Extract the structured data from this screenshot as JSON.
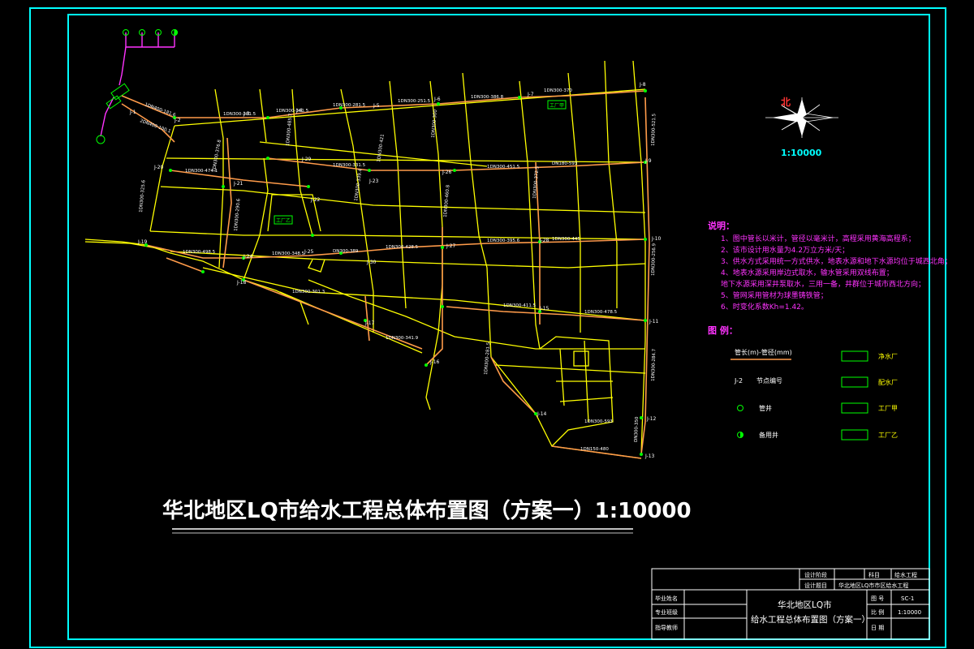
{
  "title_text": "华北地区LQ市给水工程总体布置图（方案一）1:10000",
  "north": {
    "char": "北",
    "scale": "1:10000"
  },
  "notes": {
    "heading": "说明：",
    "items": [
      "1、图中管长以米计，管径以毫米计，高程采用黄海高程系；",
      "2、该市设计用水量为4.2万立方米/天；",
      "3、供水方式采用统一方式供水，地表水源和地下水源均位于城西北角；",
      "4、地表水源采用岸边式取水，输水管采用双线布置；",
      "   地下水源采用深井泵取水，三用一备，井群位于城市西北方向；",
      "5、管网采用管材为球墨铸铁管；",
      "6、时变化系数Kh=1.42。"
    ]
  },
  "legend": {
    "heading": "图 例：",
    "pipe_label": "管长(m)-管径(mm)",
    "node_symbol": "J-2",
    "node_label": "节点编号",
    "well_label": "管井",
    "standby_well_label": "备用井",
    "plants": [
      "净水厂",
      "配水厂",
      "工厂甲",
      "工厂乙"
    ]
  },
  "map_labels": {
    "plant_a": "工厂甲",
    "plant_b": "工厂乙",
    "nodes": [
      "J-1",
      "J-2",
      "J-3",
      "J-4",
      "J-5",
      "J-6",
      "J-7",
      "J-8",
      "J-9",
      "J-10",
      "J-11",
      "J-12",
      "J-13",
      "J-14",
      "J-15",
      "J-16",
      "J-17",
      "J-18",
      "J-19",
      "J-20",
      "J-21",
      "J-22",
      "J-23",
      "J-24",
      "J-25",
      "J-26",
      "J-27",
      "J-28",
      "J-29",
      "J-30"
    ],
    "pipes": [
      "1DN300-281.5",
      "1DN300-361.5",
      "1DN300-281.5",
      "1DN300-251.5",
      "1DN300-386.8",
      "1DN300-370",
      "1DN300-474.1",
      "1DN300-331.5",
      "1DN300-451.5",
      "DN180-593",
      "1DN300-498.5",
      "1DN300-348.5",
      "DN300-389",
      "1DN300-428.5",
      "1DN300-445",
      "1DN300-395.6",
      "1DN300-411.5",
      "1DN300-478.5",
      "1DN300-593",
      "1DN150-480",
      "1DN300-301.3",
      "1DN300-341.9",
      "1DN300-325.6",
      "1DN300-376.8",
      "1DN300-290.6",
      "1DN300-485.7",
      "1DN300-339.4",
      "1DN300-421",
      "1DN300-300",
      "1DN300-460.8",
      "1DN300-372.5",
      "1DN300-521.5",
      "1DN300-256.9",
      "1DN300-284.7",
      "1DN300-281.5",
      "DN300-350",
      "1DN400-181.6",
      "2DN400-100.1"
    ]
  },
  "title_block": {
    "r1": [
      "设计阶段",
      "科目",
      "给水工程"
    ],
    "r2": [
      "设计题目",
      "华北地区LQ市市区给水工程"
    ],
    "left_labels": [
      "毕业姓名",
      "专业班级",
      "指导教师"
    ],
    "center_line1": "华北地区LQ市",
    "center_line2": "给水工程总体布置图（方案一）",
    "right_labels": [
      "图 号",
      "比 例",
      "日 期"
    ],
    "right_values": [
      "SC-1",
      "1:10000",
      ""
    ]
  },
  "colors": {
    "frame": "#00ffff",
    "roads": "#ffff00",
    "pipes": "#ff9b4a",
    "intake": "#ff33ff",
    "plants": "#00ff00",
    "notes": "#ff33ff"
  }
}
